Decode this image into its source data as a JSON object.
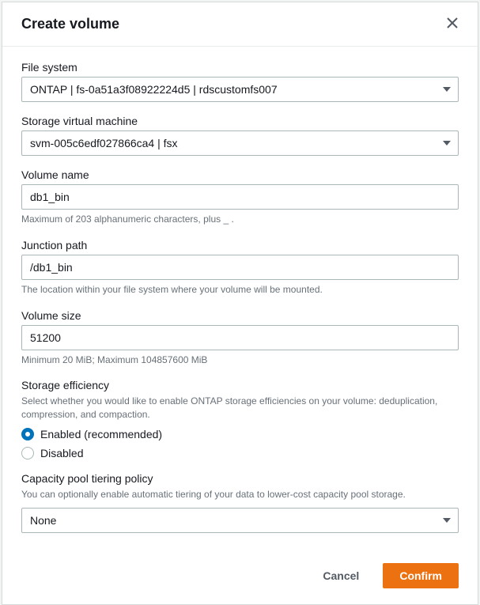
{
  "header": {
    "title": "Create volume"
  },
  "fields": {
    "file_system": {
      "label": "File system",
      "value": "ONTAP | fs-0a51a3f08922224d5 | rdscustomfs007"
    },
    "svm": {
      "label": "Storage virtual machine",
      "value": "svm-005c6edf027866ca4 | fsx"
    },
    "volume_name": {
      "label": "Volume name",
      "value": "db1_bin",
      "help": "Maximum of 203 alphanumeric characters, plus _ ."
    },
    "junction_path": {
      "label": "Junction path",
      "value": "/db1_bin",
      "help": "The location within your file system where your volume will be mounted."
    },
    "volume_size": {
      "label": "Volume size",
      "value": "51200",
      "help": "Minimum 20 MiB; Maximum 104857600 MiB"
    },
    "storage_efficiency": {
      "label": "Storage efficiency",
      "desc": "Select whether you would like to enable ONTAP storage efficiencies on your volume: deduplication, compression, and compaction.",
      "option_enabled": "Enabled (recommended)",
      "option_disabled": "Disabled"
    },
    "tiering": {
      "label": "Capacity pool tiering policy",
      "desc": "You can optionally enable automatic tiering of your data to lower-cost capacity pool storage.",
      "value": "None"
    }
  },
  "footer": {
    "cancel": "Cancel",
    "confirm": "Confirm"
  }
}
